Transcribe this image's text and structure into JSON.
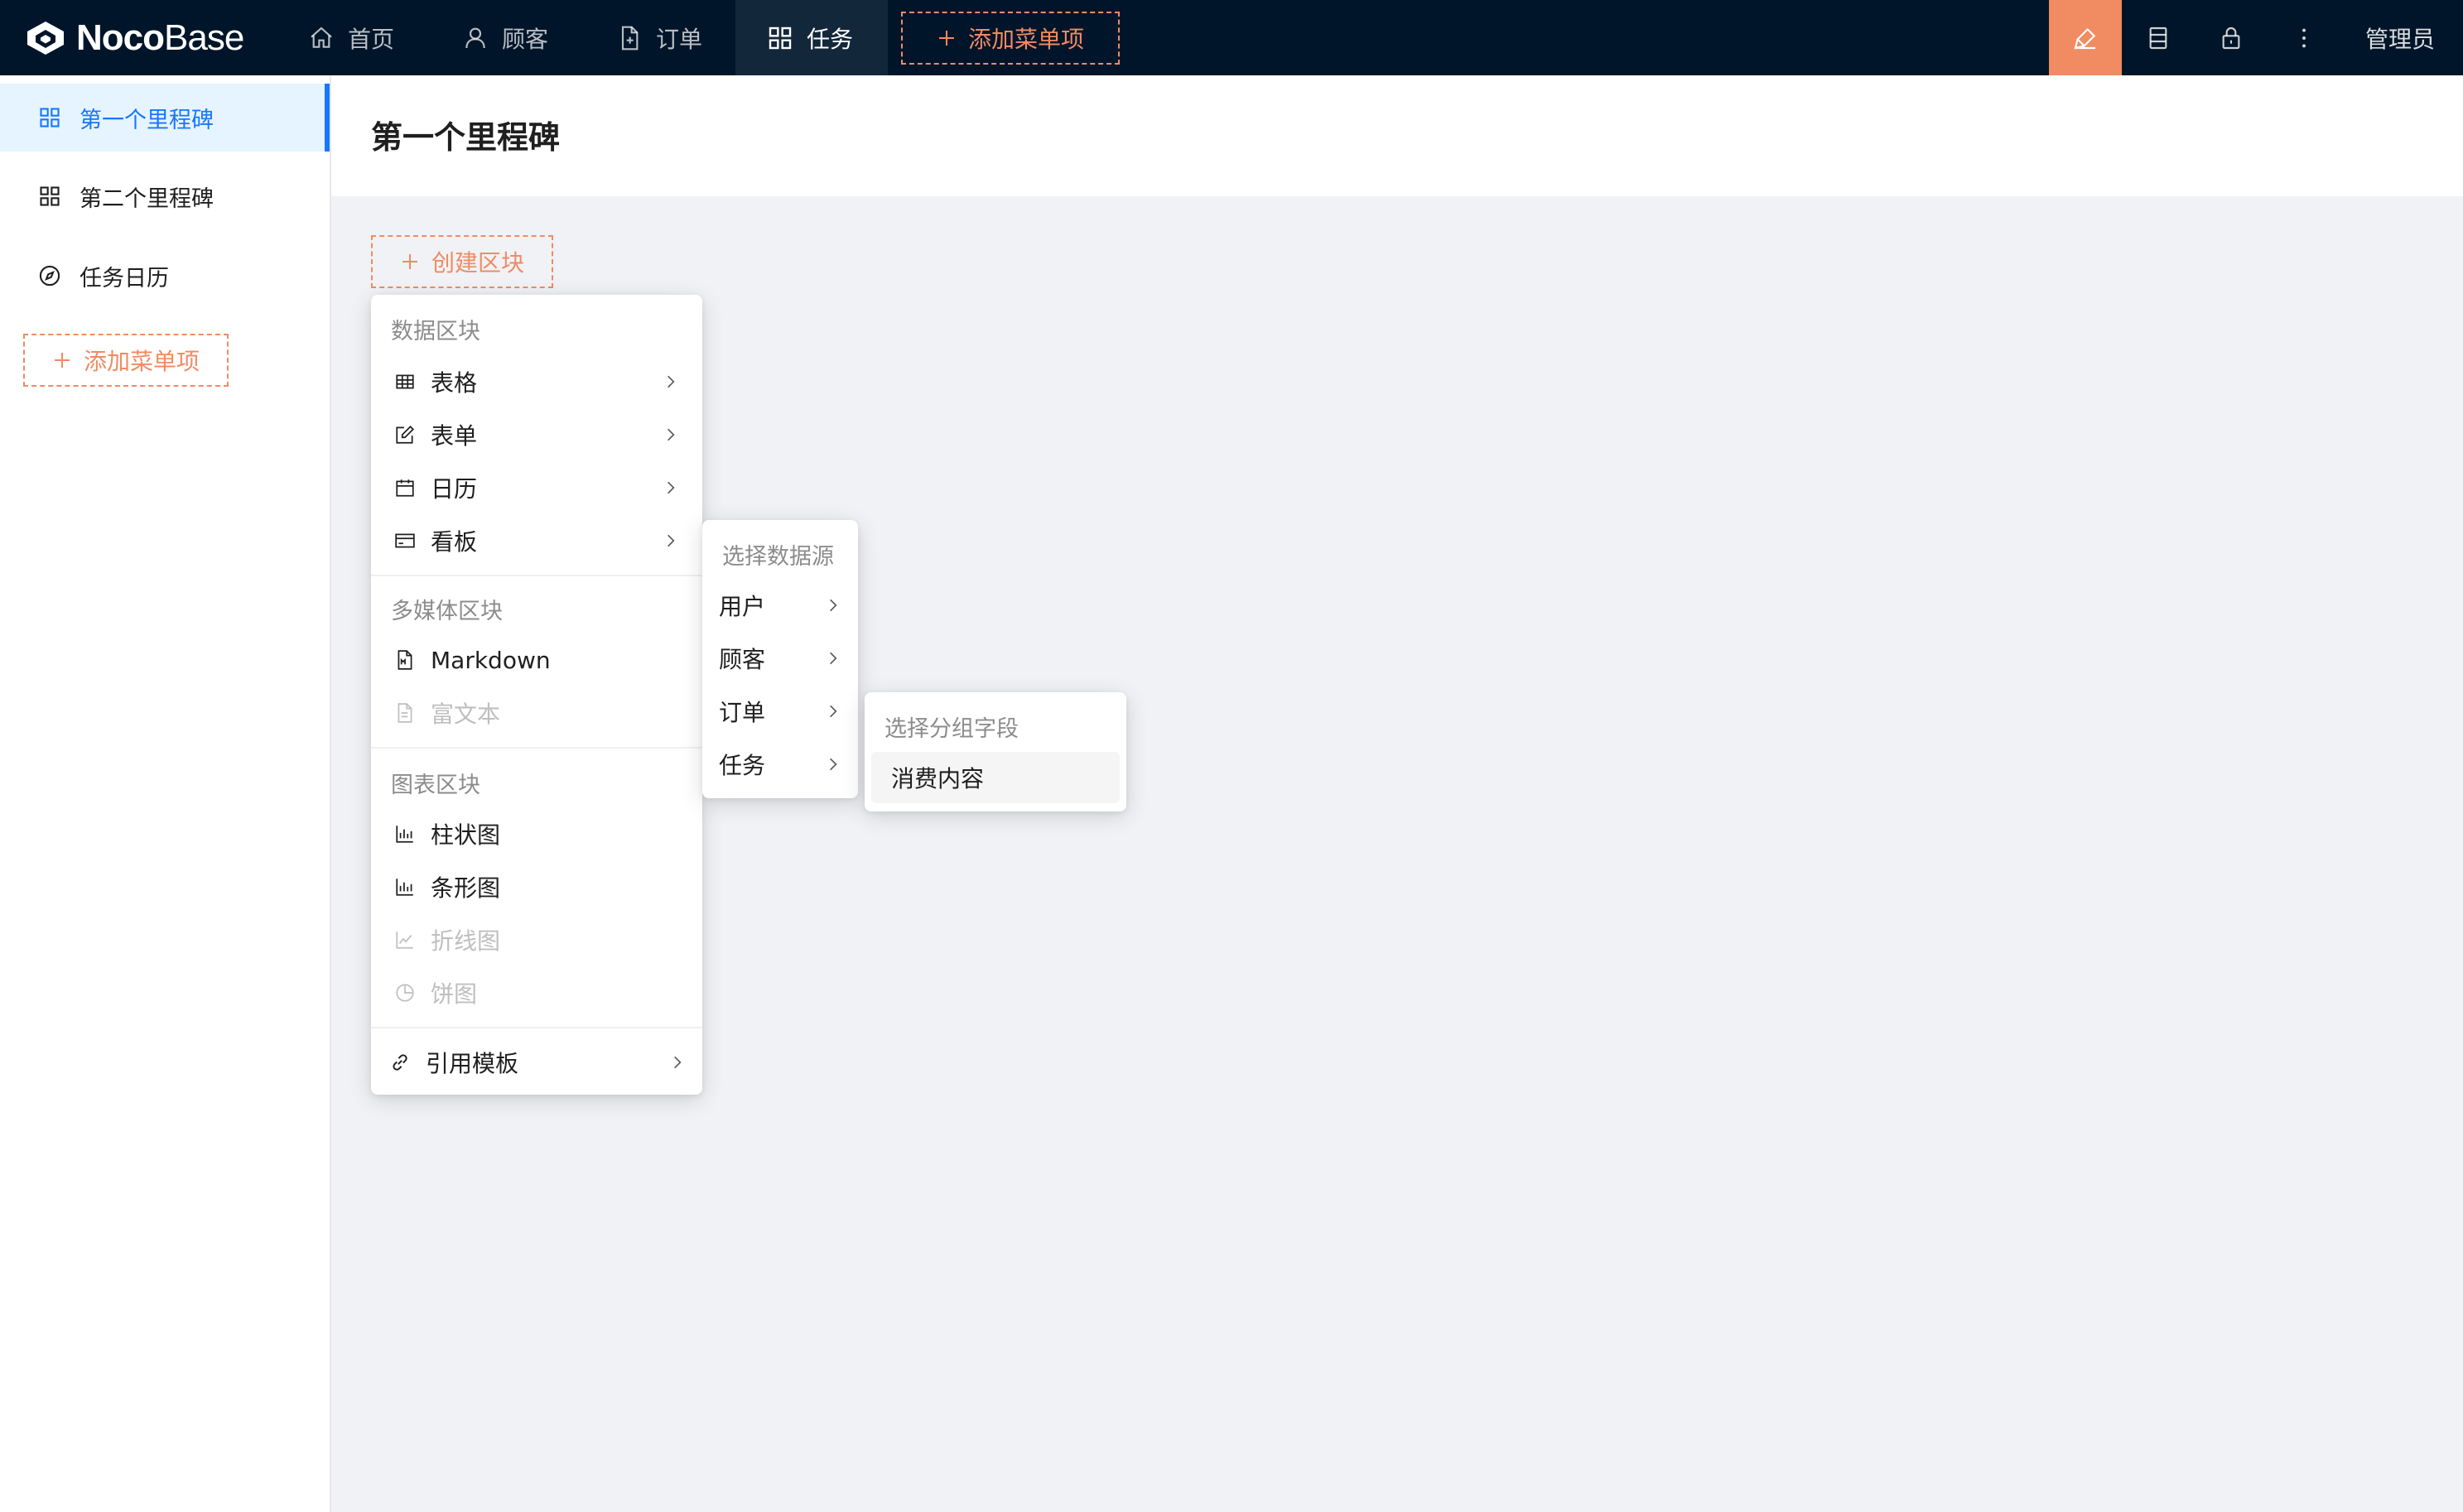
{
  "app": {
    "logo_bold": "Noco",
    "logo_light": "Base"
  },
  "topnav": {
    "items": [
      {
        "label": "首页",
        "icon": "home-icon"
      },
      {
        "label": "顾客",
        "icon": "user-icon"
      },
      {
        "label": "订单",
        "icon": "file-icon"
      },
      {
        "label": "任务",
        "icon": "appstore-icon",
        "active": true
      }
    ],
    "add_menu_label": "添加菜单项",
    "tools": [
      "highlight-icon",
      "database-icon",
      "lock-icon",
      "more-icon"
    ],
    "user_label": "管理员"
  },
  "sidebar": {
    "items": [
      {
        "label": "第一个里程碑",
        "icon": "appstore-icon",
        "active": true
      },
      {
        "label": "第二个里程碑",
        "icon": "appstore-icon"
      },
      {
        "label": "任务日历",
        "icon": "compass-icon"
      }
    ],
    "add_label": "添加菜单项"
  },
  "page": {
    "title": "第一个里程碑",
    "create_block_label": "创建区块"
  },
  "block_menu": {
    "groups": [
      {
        "title": "数据区块",
        "items": [
          {
            "label": "表格",
            "icon": "table-icon",
            "submenu": true
          },
          {
            "label": "表单",
            "icon": "form-icon",
            "submenu": true
          },
          {
            "label": "日历",
            "icon": "calendar-icon",
            "submenu": true
          },
          {
            "label": "看板",
            "icon": "kanban-icon",
            "submenu": true
          }
        ]
      },
      {
        "title": "多媒体区块",
        "items": [
          {
            "label": "Markdown",
            "icon": "markdown-icon"
          },
          {
            "label": "富文本",
            "icon": "file-text-icon",
            "disabled": true
          }
        ]
      },
      {
        "title": "图表区块",
        "items": [
          {
            "label": "柱状图",
            "icon": "bar-chart-icon"
          },
          {
            "label": "条形图",
            "icon": "bar-chart-icon"
          },
          {
            "label": "折线图",
            "icon": "line-chart-icon",
            "disabled": true
          },
          {
            "label": "饼图",
            "icon": "pie-chart-icon",
            "disabled": true
          }
        ]
      }
    ],
    "template_label": "引用模板"
  },
  "datasource_menu": {
    "title": "选择数据源",
    "items": [
      "用户",
      "顾客",
      "订单",
      "任务"
    ]
  },
  "group_field_menu": {
    "title": "选择分组字段",
    "items": [
      "消费内容"
    ]
  },
  "colors": {
    "accent": "#f18b62",
    "primary": "#1677ff",
    "nav_bg": "#001529"
  }
}
